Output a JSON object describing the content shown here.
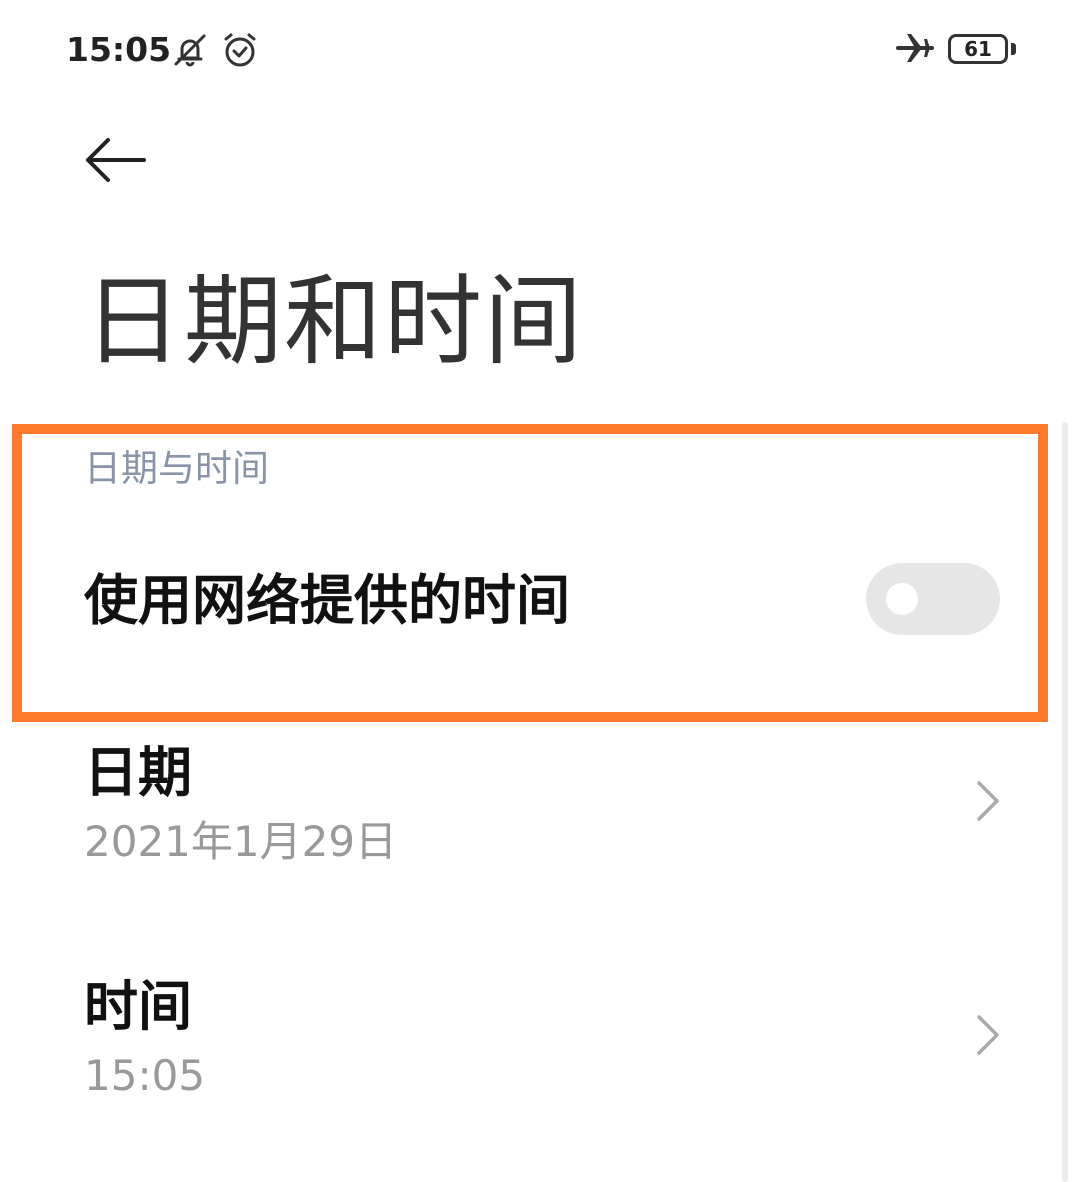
{
  "status_bar": {
    "time": "15:05",
    "icons": [
      "bell-muted-icon",
      "alarm-clock-icon",
      "airplane-icon",
      "battery-icon"
    ],
    "battery_level": "61"
  },
  "header": {
    "back_icon": "arrow-left-icon",
    "title": "日期和时间"
  },
  "section": {
    "label": "日期与时间",
    "highlight_color": "#ff7a2d",
    "network_time": {
      "label": "使用网络提供的时间",
      "enabled": false
    }
  },
  "rows": [
    {
      "title": "日期",
      "value": "2021年1月29日"
    },
    {
      "title": "时间",
      "value": "15:05"
    }
  ],
  "colors": {
    "section_label": "#8a94a8",
    "toggle_off": "#e6e6e6",
    "secondary_text": "#999999"
  }
}
